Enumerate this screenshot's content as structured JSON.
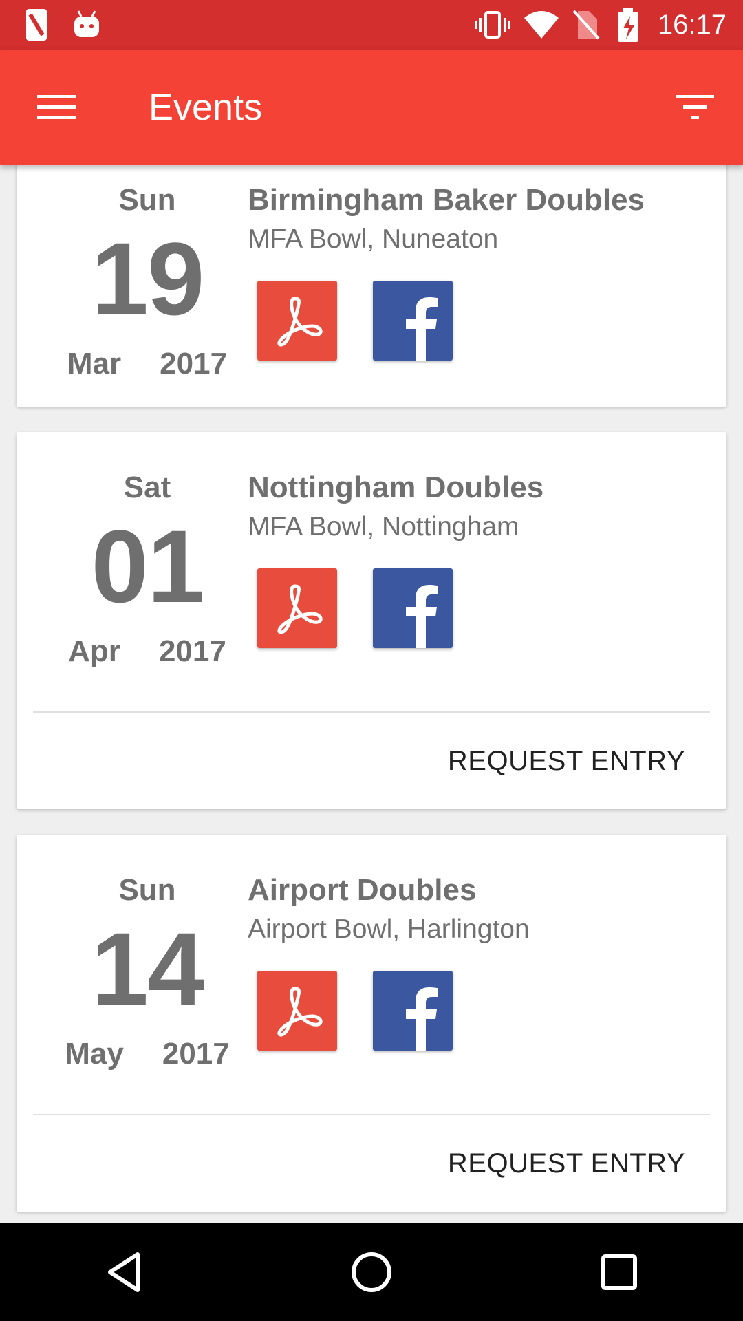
{
  "status_bar": {
    "time": "16:17"
  },
  "app_bar": {
    "title": "Events"
  },
  "events": [
    {
      "dow": "Sun",
      "day": "19",
      "month": "Mar",
      "year": "2017",
      "name": "Birmingham Baker Doubles",
      "venue": "MFA Bowl, Nuneaton"
    },
    {
      "dow": "Sat",
      "day": "01",
      "month": "Apr",
      "year": "2017",
      "name": "Nottingham Doubles",
      "venue": "MFA Bowl, Nottingham",
      "action": "REQUEST ENTRY"
    },
    {
      "dow": "Sun",
      "day": "14",
      "month": "May",
      "year": "2017",
      "name": "Airport Doubles",
      "venue": "Airport Bowl, Harlington",
      "action": "REQUEST ENTRY"
    }
  ],
  "icons": {
    "pdf": "pdf-icon",
    "facebook": "facebook-icon",
    "menu": "menu-icon",
    "filter": "filter-icon"
  },
  "colors": {
    "status_bar": "#d32f2f",
    "app_bar": "#f44336",
    "pdf": "#e84c3d",
    "facebook": "#3b57a0"
  }
}
